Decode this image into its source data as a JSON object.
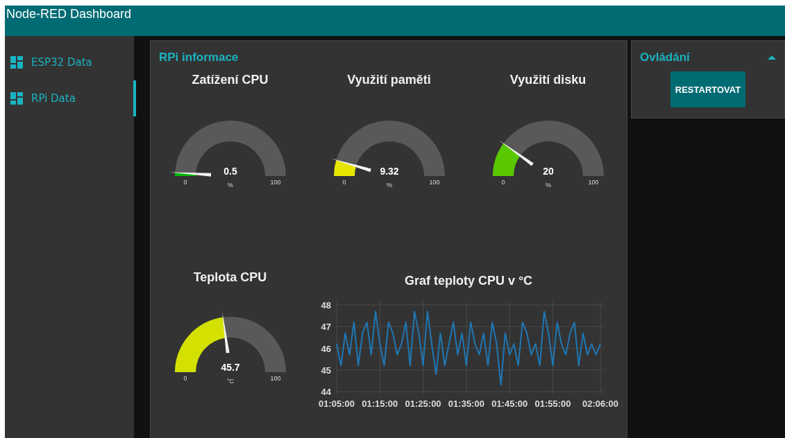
{
  "header": {
    "title": "Node-RED Dashboard"
  },
  "sidebar": {
    "items": [
      {
        "label": "ESP32 Data",
        "selected": false
      },
      {
        "label": "RPi Data",
        "selected": true
      }
    ]
  },
  "main_group": {
    "title": "RPi informace",
    "gauges": [
      {
        "title": "Zatížení CPU",
        "value": "0.5",
        "unit": "%",
        "min": "0",
        "max": "100",
        "color": "#00b500"
      },
      {
        "title": "Využití paměti",
        "value": "9.32",
        "unit": "%",
        "min": "0",
        "max": "100",
        "color": "#e6e600"
      },
      {
        "title": "Využití disku",
        "value": "20",
        "unit": "%",
        "min": "0",
        "max": "100",
        "color": "#5ac800"
      },
      {
        "title": "Teplota CPU",
        "value": "45.7",
        "unit": "°C",
        "min": "0",
        "max": "100",
        "color": "#d4e000"
      }
    ],
    "chart": {
      "title": "Graf teploty CPU v °C",
      "chart_data": {
        "type": "line",
        "categories": [
          "01:05:00",
          null,
          null,
          null,
          null,
          null,
          null,
          null,
          null,
          null,
          "01:15:00",
          null,
          null,
          null,
          null,
          null,
          null,
          null,
          null,
          null,
          "01:25:00",
          null,
          null,
          null,
          null,
          null,
          null,
          null,
          null,
          null,
          "01:35:00",
          null,
          null,
          null,
          null,
          null,
          null,
          null,
          null,
          null,
          "01:45:00",
          null,
          null,
          null,
          null,
          null,
          null,
          null,
          null,
          null,
          "01:55:00",
          null,
          null,
          null,
          null,
          null,
          null,
          null,
          null,
          null,
          null,
          "02:06:00"
        ],
        "series": [
          {
            "color": "#1f77b4",
            "values": [
              46.2,
              45.2,
              46.7,
              45.7,
              47.2,
              45.2,
              46.7,
              47.2,
              45.7,
              47.7,
              46.2,
              45.2,
              47.2,
              46.7,
              45.7,
              46.2,
              47.2,
              45.2,
              47.7,
              46.7,
              45.2,
              47.7,
              46.2,
              44.8,
              46.7,
              45.2,
              46.2,
              47.2,
              45.7,
              46.7,
              45.2,
              47.2,
              46.2,
              45.7,
              46.7,
              45.2,
              47.2,
              46.2,
              44.3,
              46.7,
              45.7,
              46.2,
              45.2,
              47.2,
              46.7,
              45.7,
              46.2,
              45.2,
              47.7,
              46.7,
              45.2,
              47.2,
              46.2,
              45.7,
              46.7,
              47.2,
              45.2,
              46.7,
              45.7,
              46.2,
              45.7,
              46.2
            ]
          }
        ],
        "ylim": [
          44,
          48
        ],
        "grid": true,
        "yticks": [
          44,
          45,
          46,
          47,
          48
        ]
      }
    }
  },
  "control_group": {
    "title": "Ovládání",
    "expanded": true,
    "button": "RESTARTOVAT"
  }
}
